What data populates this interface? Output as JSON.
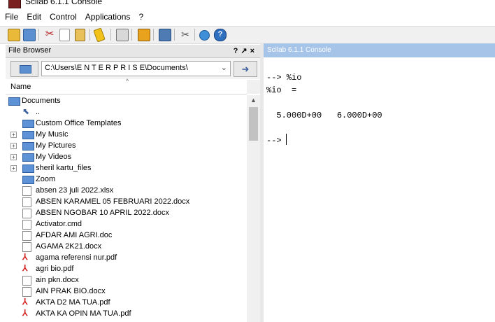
{
  "window": {
    "title": "Scilab 6.1.1 Console"
  },
  "menu": [
    "File",
    "Edit",
    "Control",
    "Applications",
    "?"
  ],
  "toolbar_icons": [
    "new-script-icon",
    "open-file-icon",
    "cut-icon",
    "copy-icon",
    "paste-icon",
    "clear-console-icon",
    "print-icon",
    "change-directory-icon",
    "variable-browser-icon",
    "module-manager-icon",
    "applications-icon",
    "help-icon"
  ],
  "file_browser": {
    "title": "File Browser",
    "controls": [
      "?",
      "↗",
      "×"
    ],
    "path": "C:\\Users\\E N T E R P R I S E\\Documents\\",
    "column_name": "Name",
    "items": [
      {
        "name": "Documents",
        "type": "folder",
        "level": 0
      },
      {
        "name": "..",
        "type": "up",
        "level": 1
      },
      {
        "name": "Custom Office Templates",
        "type": "folder",
        "level": 1
      },
      {
        "name": "My Music",
        "type": "folder",
        "level": 1,
        "expandable": true
      },
      {
        "name": "My Pictures",
        "type": "folder",
        "level": 1,
        "expandable": true
      },
      {
        "name": "My Videos",
        "type": "folder",
        "level": 1,
        "expandable": true
      },
      {
        "name": "sheril kartu_files",
        "type": "folder",
        "level": 1,
        "expandable": true
      },
      {
        "name": "Zoom",
        "type": "folder",
        "level": 1
      },
      {
        "name": "absen 23 juli 2022.xlsx",
        "type": "file",
        "level": 1
      },
      {
        "name": "ABSEN KARAMEL 05 FEBRUARI 2022.docx",
        "type": "file",
        "level": 1
      },
      {
        "name": "ABSEN NGOBAR 10 APRIL 2022.docx",
        "type": "file",
        "level": 1
      },
      {
        "name": "Activator.cmd",
        "type": "file",
        "level": 1
      },
      {
        "name": "AFDAR AMI AGRI.doc",
        "type": "file",
        "level": 1
      },
      {
        "name": "AGAMA 2K21.docx",
        "type": "file",
        "level": 1
      },
      {
        "name": "agama referensi nur.pdf",
        "type": "pdf",
        "level": 1
      },
      {
        "name": "agri bio.pdf",
        "type": "pdf",
        "level": 1
      },
      {
        "name": "ain pkn.docx",
        "type": "file",
        "level": 1
      },
      {
        "name": "AIN PRAK BIO.docx",
        "type": "file",
        "level": 1
      },
      {
        "name": "AKTA D2 MA TUA.pdf",
        "type": "pdf",
        "level": 1
      },
      {
        "name": "AKTA KA OPIN MA TUA.pdf",
        "type": "pdf",
        "level": 1
      }
    ]
  },
  "console": {
    "title": "Scilab 6.1.1 Console",
    "lines": [
      "--> %io",
      "%io  =",
      "",
      "  5.000D+00   6.000D+00",
      "",
      "--> "
    ]
  }
}
